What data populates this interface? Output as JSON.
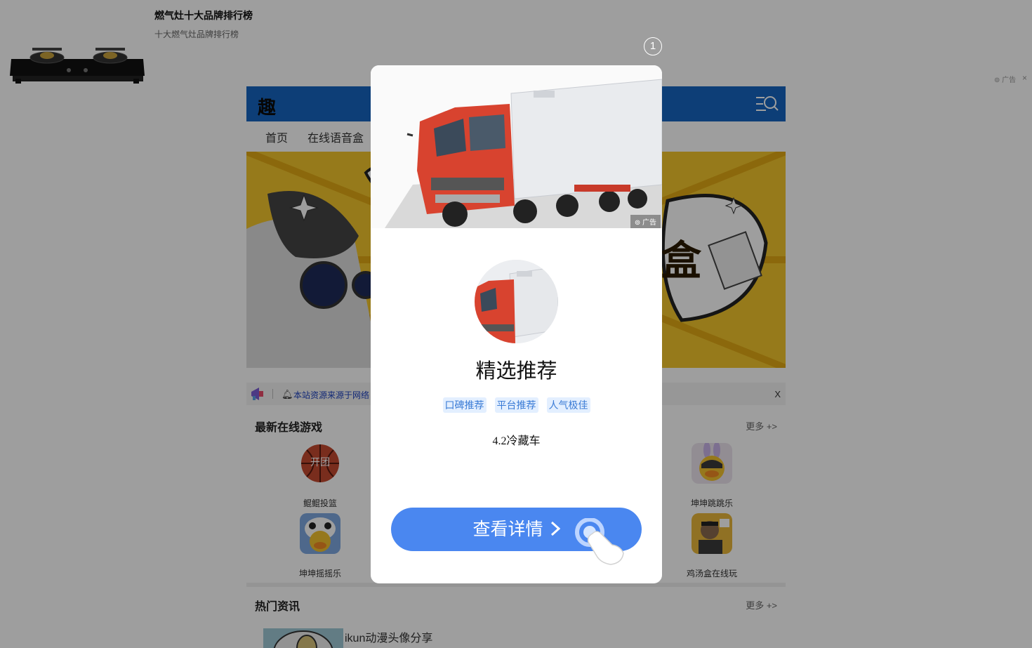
{
  "top_ad": {
    "title": "燃气灶十大品牌排行榜",
    "subtitle": "十大燃气灶品牌排行榜",
    "ad_label": "广告",
    "close": "×"
  },
  "site": {
    "logo": "趣",
    "nav": [
      "首页",
      "在线语音盒"
    ],
    "notice": {
      "text": "本站资源来源于网络",
      "close": "X"
    },
    "games_section": {
      "title": "最新在线游戏",
      "more": "更多 +>",
      "games": [
        {
          "name": "鲲鲲投篮",
          "badge": "开团"
        },
        {
          "name": "坤坤跳跳乐"
        },
        {
          "name": "坤坤摇摇乐"
        },
        {
          "name": "鸡汤盒在线玩"
        }
      ]
    },
    "news_section": {
      "title": "热门资讯",
      "more": "更多 +>",
      "items": [
        {
          "title": "ikun动漫头像分享"
        }
      ]
    }
  },
  "popup": {
    "counter": "1",
    "ad_label": "广告",
    "title": "精选推荐",
    "tags": [
      "口碑推荐",
      "平台推荐",
      "人气极佳"
    ],
    "description": "4.2冷藏车",
    "button_label": "查看详情"
  },
  "colors": {
    "site_header": "#1565c0",
    "button": "#4a87f0",
    "tag_bg": "#e3efff",
    "tag_text": "#3a7bd5",
    "banner_yellow": "#f3c52c"
  }
}
